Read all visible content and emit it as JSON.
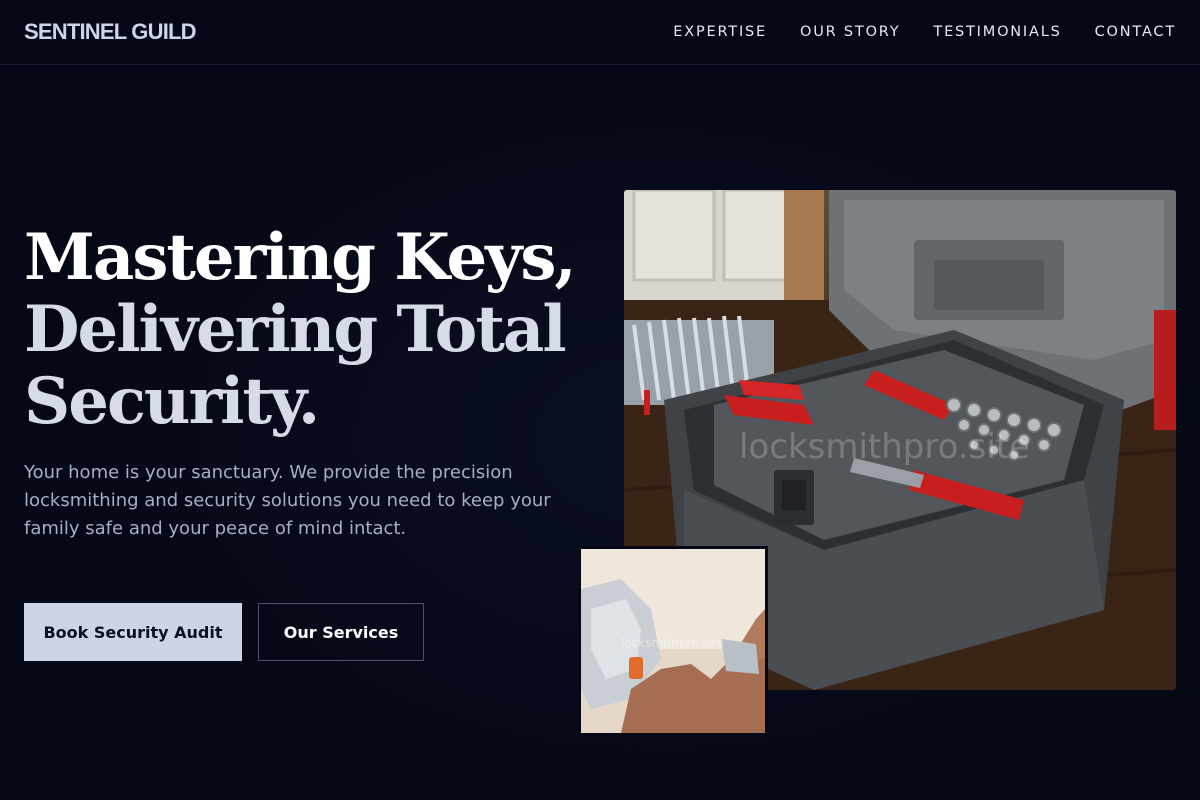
{
  "brand": {
    "name": "SENTINEL GUILD"
  },
  "nav": {
    "items": [
      {
        "label": "EXPERTISE"
      },
      {
        "label": "OUR STORY"
      },
      {
        "label": "TESTIMONIALS"
      },
      {
        "label": "CONTACT"
      }
    ]
  },
  "hero": {
    "title_line1": "Mastering Keys,",
    "title_line2": "Delivering Total",
    "title_line3": "Security.",
    "description": "Your home is your sanctuary. We provide the precision locksmithing and security solutions you need to keep your family safe and your peace of mind intact.",
    "primary_button": "Book Security Audit",
    "secondary_button": "Our Services"
  },
  "images": {
    "main_watermark": "locksmithpro.site",
    "sub_watermark": "locksmithpro.site"
  },
  "colors": {
    "background": "#050816",
    "primary_button_bg": "#cdd5e4",
    "accent_red": "#c81e1e"
  }
}
